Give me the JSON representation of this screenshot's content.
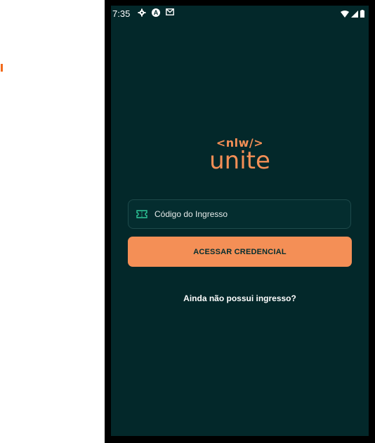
{
  "status_bar": {
    "time": "7:35",
    "left_icons": [
      "gear-icon",
      "a-circle-icon",
      "mail-icon"
    ],
    "right_icons": [
      "wifi-icon",
      "signal-icon",
      "battery-icon"
    ]
  },
  "logo": {
    "top_text": "<nlw/>",
    "bottom_text": "unite"
  },
  "ticket_input": {
    "placeholder": "Código do Ingresso",
    "value": ""
  },
  "primary_button": {
    "label": "ACESSAR CREDENCIAL"
  },
  "secondary_link": {
    "label": "Ainda não possui ingresso?"
  },
  "colors": {
    "background": "#03282a",
    "accent": "#f48f56",
    "text": "#ffffff"
  }
}
